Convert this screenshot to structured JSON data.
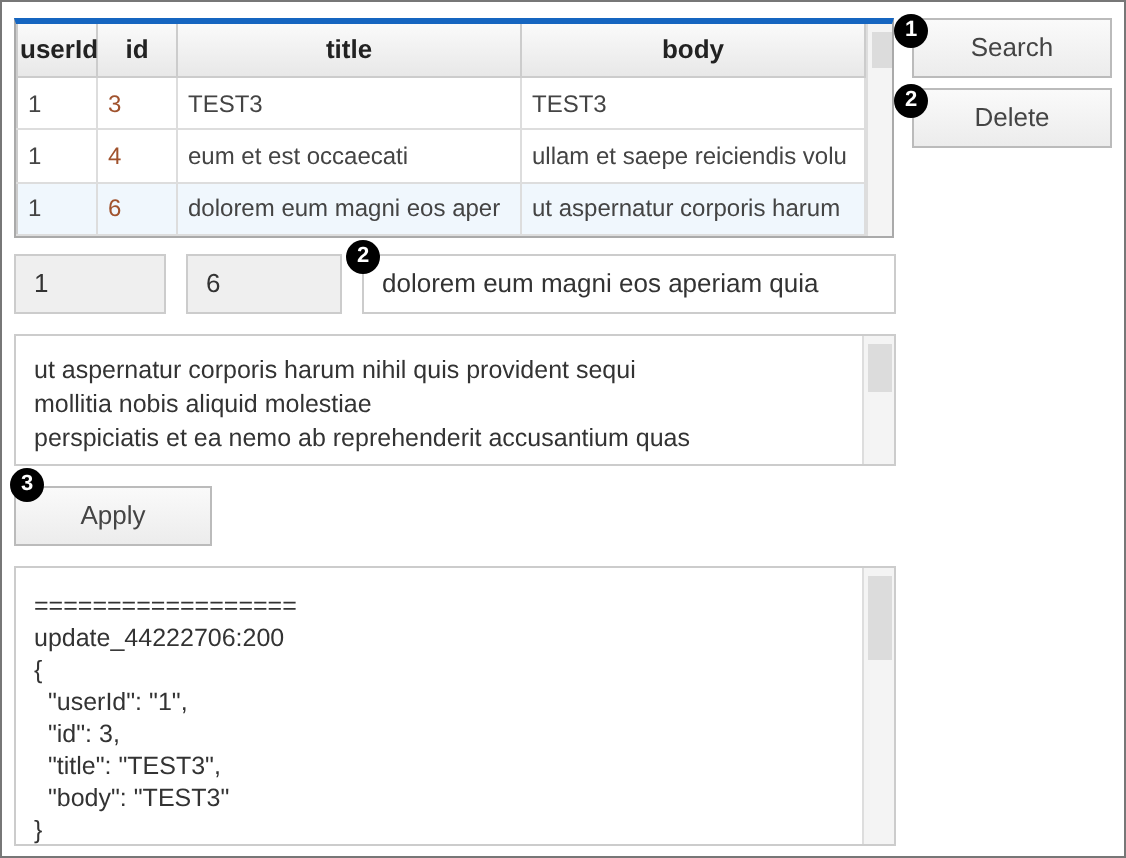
{
  "table": {
    "columns": [
      "userId",
      "id",
      "title",
      "body"
    ],
    "rows": [
      {
        "cells": [
          "1",
          "3",
          "TEST3",
          "TEST3"
        ],
        "selected": false
      },
      {
        "cells": [
          "1",
          "4",
          "eum et est occaecati",
          "ullam et saepe reiciendis volu"
        ],
        "selected": false
      },
      {
        "cells": [
          "1",
          "6",
          "dolorem eum magni eos aper",
          "ut aspernatur corporis harum"
        ],
        "selected": true
      }
    ]
  },
  "buttons": [
    {
      "label": "Search",
      "marker": "1"
    },
    {
      "label": "Delete",
      "marker": "2"
    }
  ],
  "fields": {
    "user_id": "1",
    "id": "6",
    "title": "dolorem eum magni eos aperiam quia",
    "title_marker": "2"
  },
  "body_lines": [
    "ut aspernatur corporis harum nihil quis provident sequi",
    "mollitia nobis aliquid molestiae",
    "perspiciatis et ea nemo ab reprehenderit accusantium quas"
  ],
  "apply": {
    "label": "Apply",
    "marker": "3"
  },
  "output_lines": [
    "==================",
    "update_44222706:200",
    "{",
    "  \"userId\": \"1\",",
    "  \"id\": 3,",
    "  \"title\": \"TEST3\",",
    "  \"body\": \"TEST3\"",
    "}"
  ]
}
